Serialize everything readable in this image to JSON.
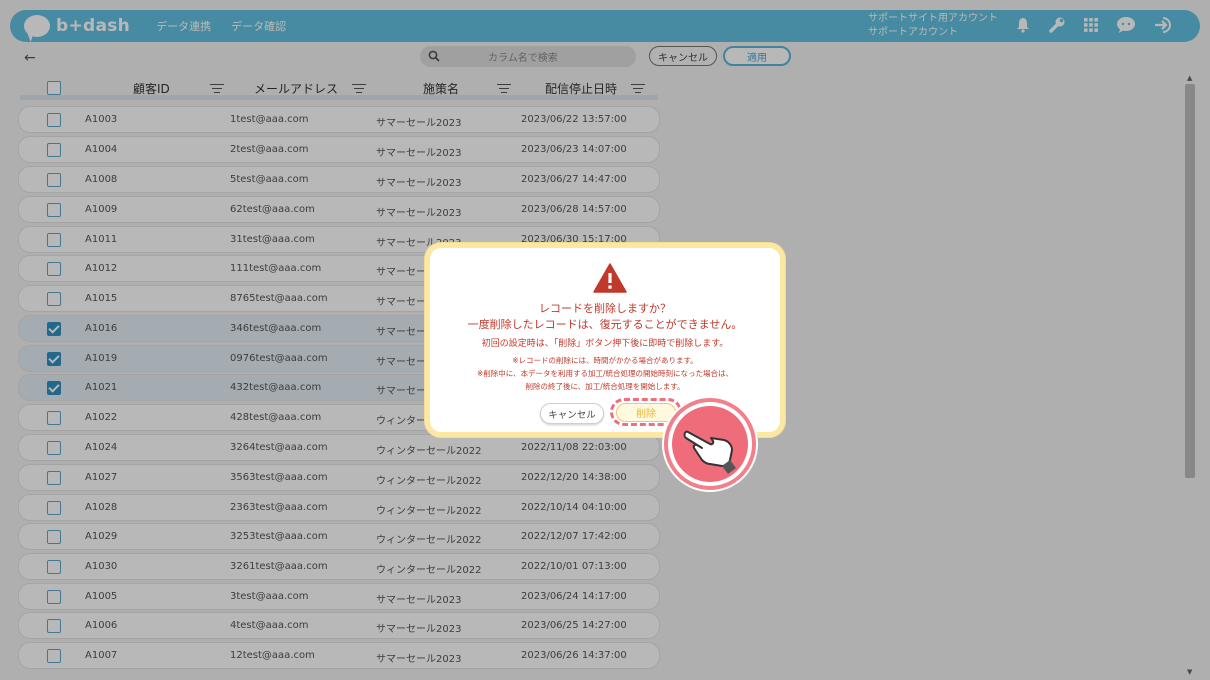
{
  "header": {
    "logo": "b+dash",
    "nav": [
      "データ連携",
      "データ確認"
    ],
    "account_line1": "サポートサイト用アカウント",
    "account_line2": "サポートアカウント"
  },
  "toolbar": {
    "back": "←",
    "search_placeholder": "カラム名で検索",
    "cancel": "キャンセル",
    "apply": "適用"
  },
  "table": {
    "columns": [
      "顧客ID",
      "メールアドレス",
      "施策名",
      "配信停止日時"
    ],
    "rows": [
      {
        "checked": false,
        "id": "A1003",
        "email": "1test@aaa.com",
        "campaign": "サマーセール2023",
        "date": "2023/06/22 13:57:00"
      },
      {
        "checked": false,
        "id": "A1004",
        "email": "2test@aaa.com",
        "campaign": "サマーセール2023",
        "date": "2023/06/23 14:07:00"
      },
      {
        "checked": false,
        "id": "A1008",
        "email": "5test@aaa.com",
        "campaign": "サマーセール2023",
        "date": "2023/06/27 14:47:00"
      },
      {
        "checked": false,
        "id": "A1009",
        "email": "62test@aaa.com",
        "campaign": "サマーセール2023",
        "date": "2023/06/28 14:57:00"
      },
      {
        "checked": false,
        "id": "A1011",
        "email": "31test@aaa.com",
        "campaign": "サマーセール2023",
        "date": "2023/06/30 15:17:00"
      },
      {
        "checked": false,
        "id": "A1012",
        "email": "111test@aaa.com",
        "campaign": "サマーセール2023",
        "date": ""
      },
      {
        "checked": false,
        "id": "A1015",
        "email": "8765test@aaa.com",
        "campaign": "サマーセール2023",
        "date": ""
      },
      {
        "checked": true,
        "id": "A1016",
        "email": "346test@aaa.com",
        "campaign": "サマーセール2023",
        "date": ""
      },
      {
        "checked": true,
        "id": "A1019",
        "email": "0976test@aaa.com",
        "campaign": "サマーセール2023",
        "date": ""
      },
      {
        "checked": true,
        "id": "A1021",
        "email": "432test@aaa.com",
        "campaign": "サマーセール2023",
        "date": ""
      },
      {
        "checked": false,
        "id": "A1022",
        "email": "428test@aaa.com",
        "campaign": "ウィンターセール2022",
        "date": ""
      },
      {
        "checked": false,
        "id": "A1024",
        "email": "3264test@aaa.com",
        "campaign": "ウィンターセール2022",
        "date": "2022/11/08 22:03:00"
      },
      {
        "checked": false,
        "id": "A1027",
        "email": "3563test@aaa.com",
        "campaign": "ウィンターセール2022",
        "date": "2022/12/20 14:38:00"
      },
      {
        "checked": false,
        "id": "A1028",
        "email": "2363test@aaa.com",
        "campaign": "ウィンターセール2022",
        "date": "2022/10/14 04:10:00"
      },
      {
        "checked": false,
        "id": "A1029",
        "email": "3253test@aaa.com",
        "campaign": "ウィンターセール2022",
        "date": "2022/12/07 17:42:00"
      },
      {
        "checked": false,
        "id": "A1030",
        "email": "3261test@aaa.com",
        "campaign": "ウィンターセール2022",
        "date": "2022/10/01 07:13:00"
      },
      {
        "checked": false,
        "id": "A1005",
        "email": "3test@aaa.com",
        "campaign": "サマーセール2023",
        "date": "2023/06/24 14:17:00"
      },
      {
        "checked": false,
        "id": "A1006",
        "email": "4test@aaa.com",
        "campaign": "サマーセール2023",
        "date": "2023/06/25 14:27:00"
      },
      {
        "checked": false,
        "id": "A1007",
        "email": "12test@aaa.com",
        "campaign": "サマーセール2023",
        "date": "2023/06/26 14:37:00"
      }
    ]
  },
  "dialog": {
    "title": "レコードを削除しますか？",
    "subtitle": "一度削除したレコードは、復元することができません。",
    "note": "初回の設定時は、「削除」ボタン押下後に即時で削除します。",
    "small1": "※レコードの削除には、時間がかかる場合があります。",
    "small2": "※削除中に、本データを利用する加工/統合処理の開始時刻になった場合は、",
    "small3": "削除の終了後に、加工/統合処理を開始します。",
    "cancel": "キャンセル",
    "delete": "削除"
  },
  "colors": {
    "header": "#63c1e1",
    "warning": "#c0392b",
    "delete_highlight": "#ef6f7d"
  }
}
